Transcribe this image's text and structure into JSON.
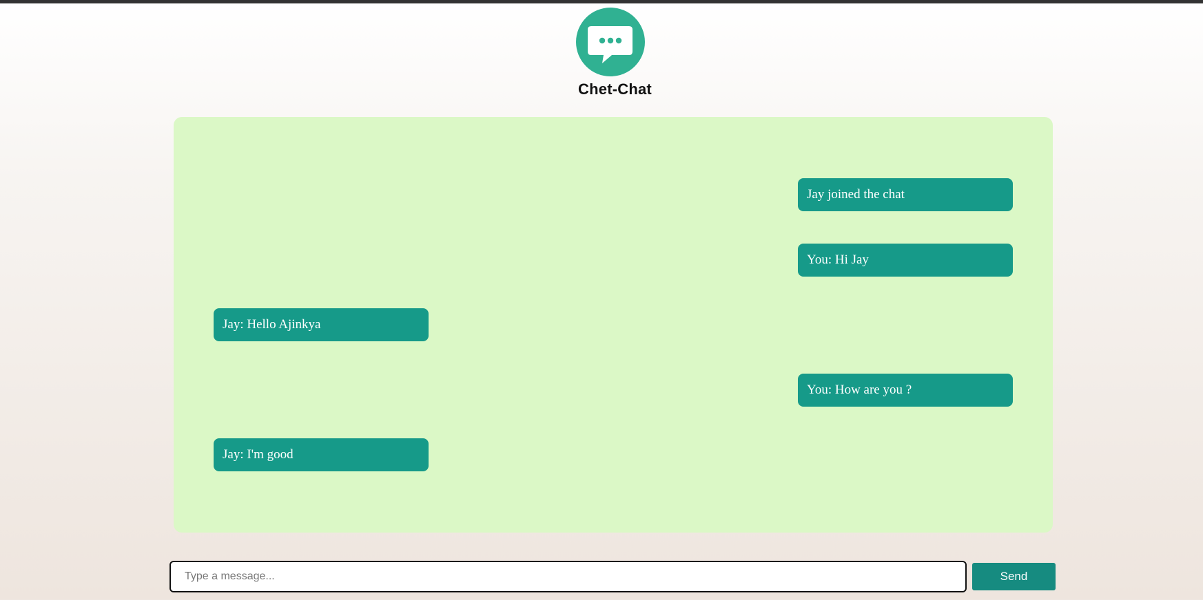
{
  "app": {
    "title": "Chet-Chat",
    "logo_icon": "chat-bubble-icon",
    "accent_color": "#30b192"
  },
  "messages": [
    {
      "text": "Jay joined the chat",
      "side": "right"
    },
    {
      "text": "You: Hi Jay",
      "side": "right"
    },
    {
      "text": "Jay: Hello Ajinkya",
      "side": "left"
    },
    {
      "text": "You: How are you ?",
      "side": "right"
    },
    {
      "text": "Jay: I'm good",
      "side": "left"
    }
  ],
  "composer": {
    "value": "",
    "placeholder": "Type a message...",
    "send_label": "Send"
  },
  "colors": {
    "chat_background": "#dbf8c6",
    "bubble": "#169a89",
    "send_button": "#168b80"
  }
}
